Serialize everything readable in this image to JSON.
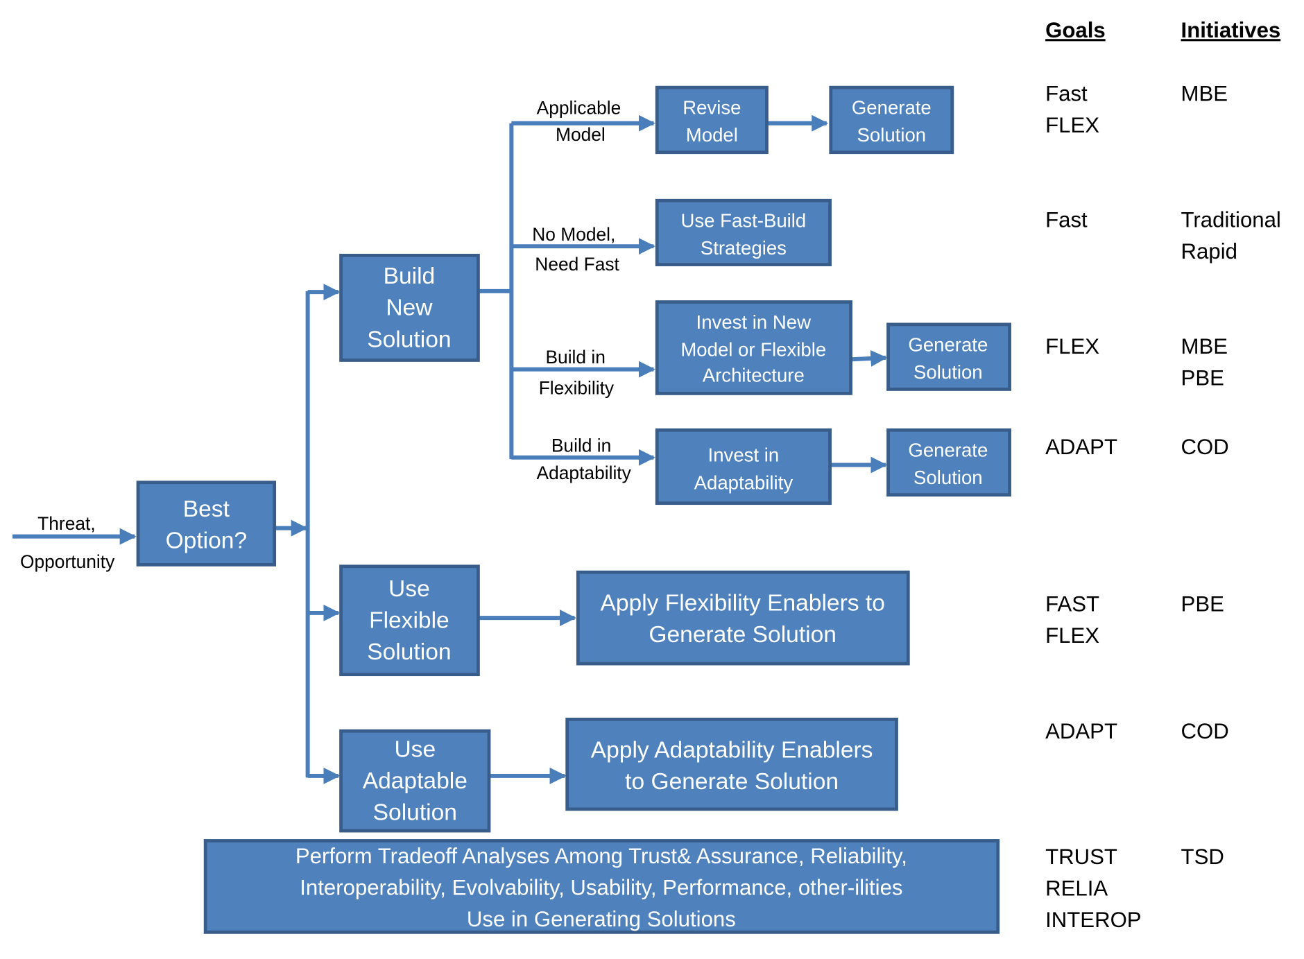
{
  "colors": {
    "box_fill": "#4f81bd",
    "box_border": "#385d8a",
    "connector": "#4a7ebb"
  },
  "input": {
    "line1": "Threat,",
    "line2": "Opportunity"
  },
  "boxes": {
    "best_option": [
      "Best",
      "Option?"
    ],
    "build_new": [
      "Build",
      "New",
      "Solution"
    ],
    "use_flexible": [
      "Use",
      "Flexible",
      "Solution"
    ],
    "use_adaptable": [
      "Use",
      "Adaptable",
      "Solution"
    ],
    "revise_model": [
      "Revise",
      "Model"
    ],
    "generate_1": [
      "Generate",
      "Solution"
    ],
    "fast_build": [
      "Use Fast-Build",
      "Strategies"
    ],
    "invest_new_model": [
      "Invest in New",
      "Model or Flexible",
      "Architecture"
    ],
    "generate_2": [
      "Generate",
      "Solution"
    ],
    "invest_adaptability": [
      "Invest in",
      "Adaptability"
    ],
    "generate_3": [
      "Generate",
      "Solution"
    ],
    "apply_flex": [
      "Apply Flexibility Enablers to",
      "Generate Solution"
    ],
    "apply_adapt": [
      "Apply Adaptability Enablers",
      "to Generate Solution"
    ],
    "tradeoff": [
      "Perform Tradeoff Analyses Among Trust& Assurance, Reliability,",
      "Interoperability, Evolvability, Usability, Performance, other-ilities",
      "Use in Generating Solutions"
    ]
  },
  "branch_labels": {
    "applicable_model": [
      "Applicable",
      "Model"
    ],
    "no_model": [
      "No Model,",
      "Need Fast"
    ],
    "build_flex": [
      "Build in",
      "Flexibility"
    ],
    "build_adapt": [
      "Build in",
      "Adaptability"
    ]
  },
  "table": {
    "goals_header": "Goals",
    "initiatives_header": "Initiatives",
    "rows": [
      {
        "goals": [
          "Fast",
          "FLEX"
        ],
        "initiatives": [
          "MBE"
        ]
      },
      {
        "goals": [
          "Fast"
        ],
        "initiatives": [
          "Traditional",
          "Rapid"
        ]
      },
      {
        "goals": [
          "FLEX"
        ],
        "initiatives": [
          "MBE",
          "PBE"
        ]
      },
      {
        "goals": [
          "ADAPT"
        ],
        "initiatives": [
          "COD"
        ]
      },
      {
        "goals": [
          "FAST",
          "FLEX"
        ],
        "initiatives": [
          "PBE"
        ]
      },
      {
        "goals": [
          "ADAPT"
        ],
        "initiatives": [
          "COD"
        ]
      },
      {
        "goals": [
          "TRUST",
          "RELIA",
          "INTEROP"
        ],
        "initiatives": [
          "TSD"
        ]
      }
    ]
  }
}
